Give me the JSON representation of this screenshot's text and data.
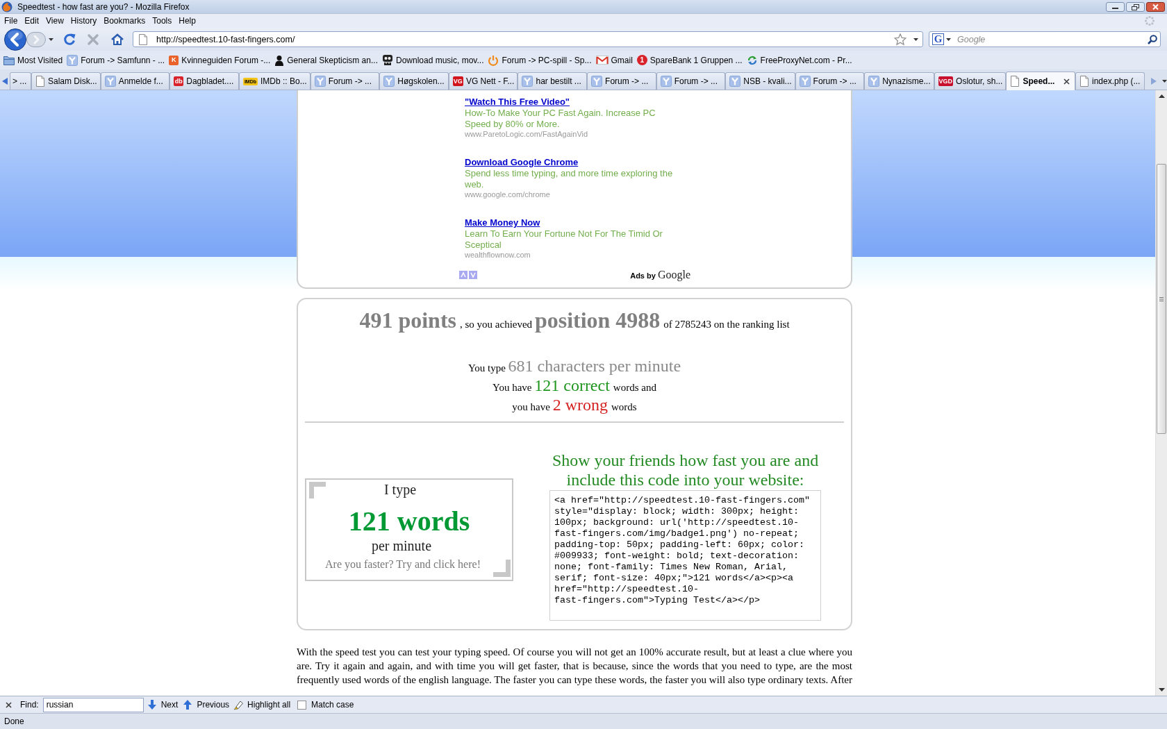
{
  "window": {
    "title": "Speedtest - how fast are you? - Mozilla Firefox"
  },
  "menu": [
    "File",
    "Edit",
    "View",
    "History",
    "Bookmarks",
    "Tools",
    "Help"
  ],
  "toolbar": {
    "buttons": [
      {
        "kind": "back",
        "disabled": false
      },
      {
        "kind": "forward",
        "disabled": true
      },
      {
        "kind": "reload",
        "disabled": false
      },
      {
        "kind": "stop",
        "disabled": true
      },
      {
        "kind": "home",
        "disabled": false
      }
    ],
    "url": "http://speedtest.10-fast-fingers.com/",
    "search_engine": "G",
    "search_placeholder": "Google"
  },
  "bookmarks": [
    {
      "kind": "smart",
      "label": "Most Visited"
    },
    {
      "kind": "forum",
      "label": "Forum -> Samfunn - ..."
    },
    {
      "kind": "letter",
      "label": "Kvinneguiden Forum -...",
      "icon_text": "K",
      "color": "#e9622b"
    },
    {
      "kind": "figure",
      "label": "General Skepticism an..."
    },
    {
      "kind": "pirate",
      "label": "Download music, mov..."
    },
    {
      "kind": "power",
      "label": "Forum -> PC-spill - Sp..."
    },
    {
      "kind": "mail",
      "label": "Gmail"
    },
    {
      "kind": "round",
      "label": "SpareBank 1 Gruppen ...",
      "icon_text": "1",
      "color": "#d9232b"
    },
    {
      "kind": "proxy",
      "label": "FreeProxyNet.com - Pr..."
    }
  ],
  "tabs": [
    {
      "kind": "partial",
      "label": "> ...",
      "selected": false
    },
    {
      "kind": "page",
      "label": "Salam Disk...",
      "selected": false
    },
    {
      "kind": "forum",
      "label": "Anmelde f...",
      "selected": false
    },
    {
      "kind": "letter",
      "label": "Dagbladet....",
      "icon_text": "db",
      "color": "#d8232a",
      "selected": false
    },
    {
      "kind": "label",
      "label": "IMDb :: Bo...",
      "icon_text": "IMDb",
      "color": "#f3c317",
      "selected": false
    },
    {
      "kind": "forum",
      "label": "Forum -> ...",
      "selected": false
    },
    {
      "kind": "forum",
      "label": "Høgskolen...",
      "selected": false
    },
    {
      "kind": "letter",
      "label": "VG Nett - F...",
      "icon_text": "VG",
      "color": "#d2141c",
      "selected": false
    },
    {
      "kind": "forum",
      "label": "har bestilt ...",
      "selected": false
    },
    {
      "kind": "forum",
      "label": "Forum -> ...",
      "selected": false
    },
    {
      "kind": "forum",
      "label": "Forum -> ...",
      "selected": false
    },
    {
      "kind": "forum",
      "label": "NSB - kvali...",
      "selected": false
    },
    {
      "kind": "forum",
      "label": "Forum -> ...",
      "selected": false
    },
    {
      "kind": "forum",
      "label": "Nynazisme...",
      "selected": false
    },
    {
      "kind": "letter",
      "label": "Oslotur, sh...",
      "icon_text": "VGD",
      "color": "#c8102e",
      "selected": false
    },
    {
      "kind": "page",
      "label": "Speed...",
      "selected": true
    },
    {
      "kind": "page",
      "label": "index.php (...",
      "selected": false
    }
  ],
  "page": {
    "ads": [
      {
        "title": "\"Watch This Free Video\"",
        "description": "How-To Make Your PC Fast Again. Increase PC Speed by 80% or More.",
        "url": "www.ParetoLogic.com/FastAgainVid"
      },
      {
        "title": "Download Google Chrome",
        "description": "Spend less time typing, and more time exploring the web.",
        "url": "www.google.com/chrome"
      },
      {
        "title": "Make Money Now",
        "description": "Learn To Earn Your Fortune Not For The Timid Or Sceptical",
        "url": "wealthflownow.com"
      }
    ],
    "ads_attribution": {
      "label": "Ads by",
      "brand": "Google"
    },
    "result_lines": [
      [
        {
          "kind": "score",
          "text": "491 points"
        },
        {
          "kind": "plain",
          "text": ", so you achieved"
        },
        {
          "kind": "score",
          "text": "position 4988"
        },
        {
          "kind": "plain",
          "text": "of 2785243 on the ranking list"
        }
      ],
      [
        {
          "kind": "plain",
          "text": "You type"
        },
        {
          "kind": "speed",
          "text": "681 characters per minute"
        }
      ],
      [
        {
          "kind": "plain",
          "text": "You have"
        },
        {
          "kind": "correct",
          "text": "121 correct"
        },
        {
          "kind": "plain",
          "text": "words and"
        }
      ],
      [
        {
          "kind": "plain",
          "text": "you have"
        },
        {
          "kind": "wrong",
          "text": "2 wrong"
        },
        {
          "kind": "plain",
          "text": "words"
        }
      ]
    ],
    "badge": [
      {
        "kind": "intro",
        "text": "I type"
      },
      {
        "kind": "count",
        "text": "121 words"
      },
      {
        "kind": "unit",
        "text": "per minute"
      },
      {
        "kind": "cta",
        "text": "Are you faster? Try and click here!"
      }
    ],
    "share": {
      "heading": "Show your friends how fast you are and include this code into your website:",
      "code_lines": [
        "<a href=\"http://speedtest.10-fast-fingers.com\"",
        "style=\"display: block; width: 300px; height:",
        "100px; background: url('http://speedtest.10-",
        "fast-fingers.com/img/badge1.png') no-repeat;",
        "padding-top: 50px; padding-left: 60px; color:",
        "#009933; font-weight: bold; text-decoration:",
        "none; font-family: Times New Roman, Arial,",
        "serif; font-size: 40px;\">121 words</a><p><a",
        "href=\"http://speedtest.10-",
        "fast-fingers.com\">Typing Test</a></p>"
      ]
    },
    "intro": "With the speed test you can test your typing speed. Of course you will not get an 100% accurate result, but at least a clue where you are. Try it again and again, and with time you will get faster, that is because, since the words that you need to type, are the most frequently used words of the english language. The faster you can type these words, the faster you will also type ordinary texts. After"
  },
  "find_bar": {
    "label": "Find:",
    "value": "russian",
    "actions": [
      {
        "kind": "next",
        "label": "Next"
      },
      {
        "kind": "previous",
        "label": "Previous"
      },
      {
        "kind": "highlight",
        "label": "Highlight all"
      }
    ],
    "match_case": {
      "label": "Match case",
      "checked": false
    }
  },
  "status_bar": {
    "text": "Done"
  }
}
